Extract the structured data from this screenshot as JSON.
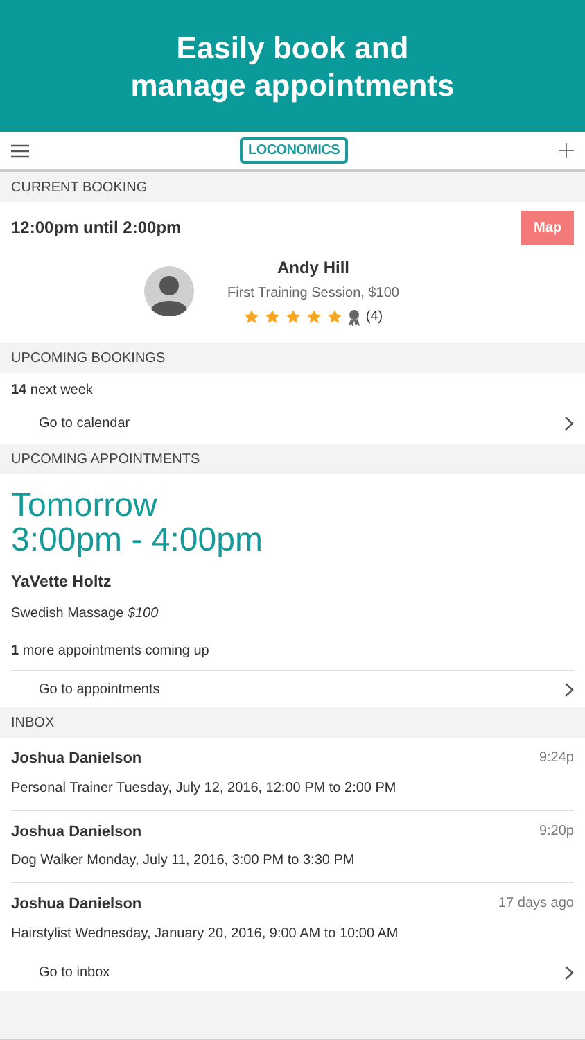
{
  "banner": {
    "title": "Easily book and manage appointments"
  },
  "navbar": {
    "logo": "LOCONOMICS"
  },
  "current_booking": {
    "header": "CURRENT BOOKING",
    "time": "12:00pm until 2:00pm",
    "map_button": "Map",
    "provider": "Andy Hill",
    "service": "First Training Session, $100",
    "stars": 5,
    "reviews": "(4)"
  },
  "upcoming_bookings": {
    "header": "UPCOMING BOOKINGS",
    "summary": "**14** next week",
    "link": "Go to calendar"
  },
  "upcoming_appointments": {
    "header": "UPCOMING APPOINTMENTS",
    "day": "Tomorrow",
    "time": "3:00pm - 4:00pm",
    "client": "YaVette Holtz",
    "service": "Swedish Massage *$100*",
    "more": "**1** more appointments coming up",
    "link": "Go to appointments"
  },
  "inbox": {
    "header": "INBOX",
    "messages": [
      {
        "sender": "Joshua Danielson",
        "time": "9:24p",
        "text": "Personal Trainer Tuesday, July 12, 2016, 12:00 PM to 2:00 PM"
      },
      {
        "sender": "Joshua Danielson",
        "time": "9:20p",
        "text": "Dog Walker Monday, July 11, 2016, 3:00 PM to 3:30 PM"
      },
      {
        "sender": "Joshua Danielson",
        "time": "17 days ago",
        "text": "Hairstylist Wednesday, January 20, 2016, 9:00 AM to 10:00 AM"
      }
    ],
    "link": "Go to inbox"
  }
}
